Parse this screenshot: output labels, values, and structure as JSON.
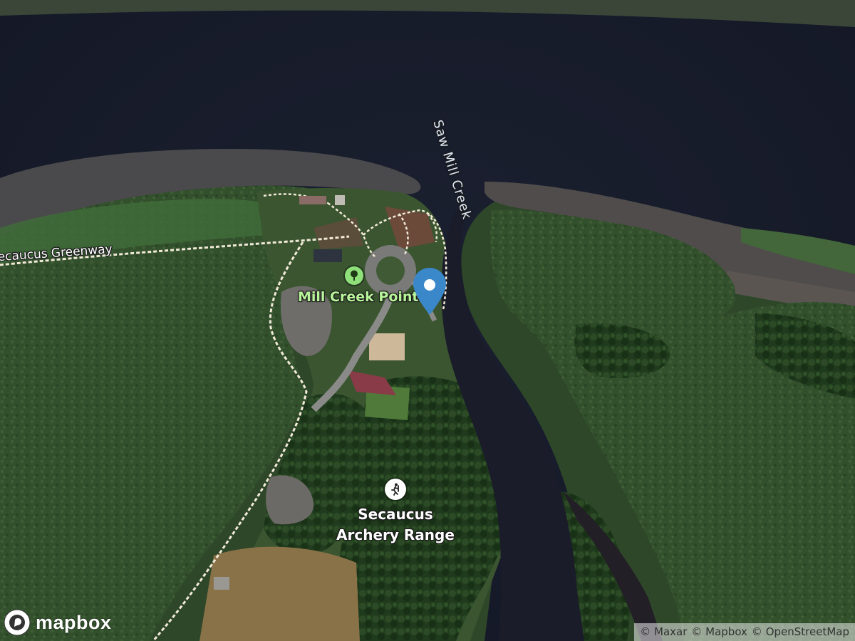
{
  "map": {
    "provider": "mapbox",
    "style": "satellite-streets",
    "water_color": "#181c2c",
    "vegetation_color": "#2f4a2a",
    "path_color": "#f2ead8"
  },
  "labels": {
    "river_name": "Saw Mill Creek",
    "greenway_name": "Secaucus Greenway",
    "park_name": "Mill Creek Point",
    "archery_line1": "Secaucus",
    "archery_line2": "Archery Range"
  },
  "pois": [
    {
      "name": "Mill Creek Point",
      "icon": "park-tree-icon",
      "color": "#8fe07a"
    },
    {
      "name": "Secaucus Archery Range",
      "icon": "archery-person-icon",
      "color": "#ffffff"
    }
  ],
  "marker": {
    "icon": "map-pin-marker",
    "color": "#3a87c9"
  },
  "branding": {
    "logo_text": "mapbox"
  },
  "attribution": [
    "© Maxar",
    "© Mapbox",
    "© OpenStreetMap"
  ]
}
